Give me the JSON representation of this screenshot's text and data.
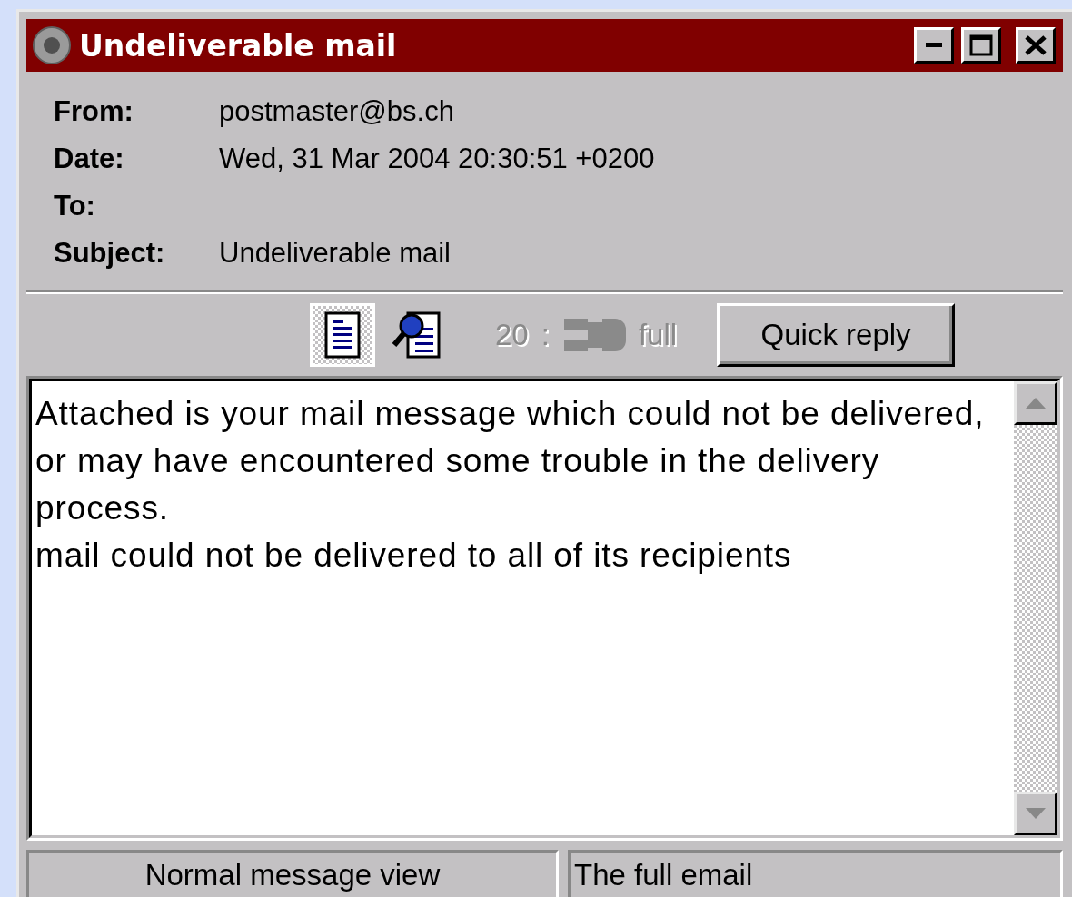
{
  "window": {
    "title": "Undeliverable mail",
    "controls": [
      {
        "kind": "minimize"
      },
      {
        "kind": "maximize"
      },
      {
        "kind": "close"
      }
    ]
  },
  "headers": [
    {
      "label": "From:",
      "value": "postmaster@bs.ch"
    },
    {
      "label": "Date:",
      "value": "Wed, 31 Mar 2004 20:30:51 +0200"
    },
    {
      "label": "To:"
    },
    {
      "label": "Subject:",
      "value": "Undeliverable mail"
    }
  ],
  "toolbar": {
    "views": [
      {
        "kind": "normal",
        "selected": true
      },
      {
        "kind": "source",
        "selected": false
      }
    ],
    "slider": {
      "min_label": "20",
      "separator": ":",
      "max_label": "full",
      "disabled": true
    },
    "quick_reply": "Quick reply"
  },
  "body": [
    "Attached is your mail message which could not be delivered, or may have encountered some trouble in the delivery process.",
    "mail could not be delivered to all of its recipients"
  ],
  "status_bar": [
    "Normal message view",
    "The full email"
  ]
}
